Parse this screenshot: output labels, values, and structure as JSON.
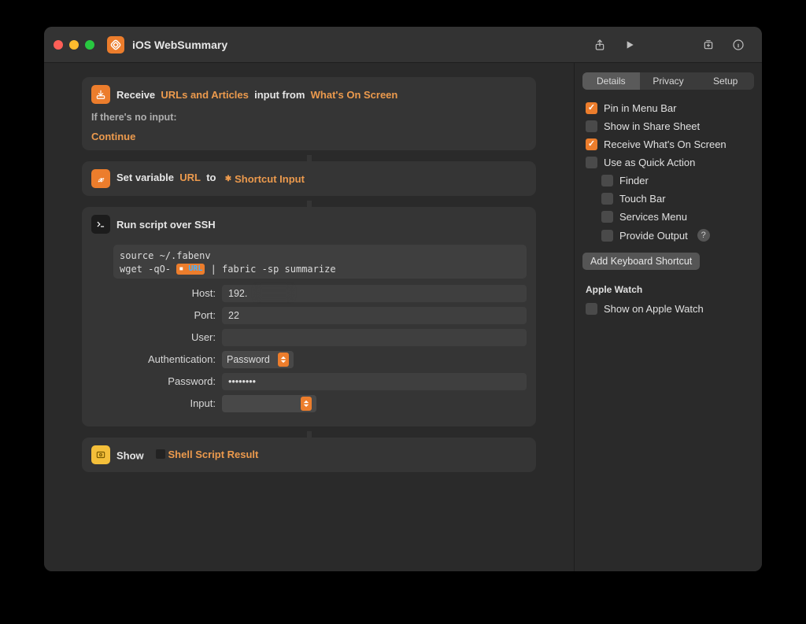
{
  "titlebar": {
    "title": "iOS WebSummary"
  },
  "canvas": {
    "receive": {
      "prefix": "Receive",
      "types": "URLs and Articles",
      "mid": "input from",
      "source": "What's On Screen",
      "no_input_label": "If there's no input:",
      "no_input_action": "Continue"
    },
    "setvar": {
      "prefix": "Set variable",
      "varname": "URL",
      "mid": "to",
      "target": "Shortcut Input"
    },
    "ssh": {
      "title": "Run script over SSH",
      "script_line1": "source ~/.fabenv",
      "script_line2a": "wget -qO- ",
      "script_url_pill": "URL",
      "script_line2b": " | fabric -sp summarize",
      "fields": {
        "host_label": "Host:",
        "host_value": "192.",
        "port_label": "Port:",
        "port_value": "22",
        "user_label": "User:",
        "user_value": "",
        "auth_label": "Authentication:",
        "auth_value": "Password",
        "pass_label": "Password:",
        "pass_value": "••••••••",
        "input_label": "Input:",
        "input_value": ""
      }
    },
    "show": {
      "prefix": "Show",
      "target": "Shell Script Result"
    }
  },
  "sidebar": {
    "tabs": {
      "details": "Details",
      "privacy": "Privacy",
      "setup": "Setup"
    },
    "checks": {
      "pin_menu": "Pin in Menu Bar",
      "share_sheet": "Show in Share Sheet",
      "receive_screen": "Receive What's On Screen",
      "quick_action": "Use as Quick Action",
      "finder": "Finder",
      "touchbar": "Touch Bar",
      "services": "Services Menu",
      "provide_output": "Provide Output"
    },
    "add_shortcut": "Add Keyboard Shortcut",
    "watch_header": "Apple Watch",
    "watch_check": "Show on Apple Watch"
  }
}
